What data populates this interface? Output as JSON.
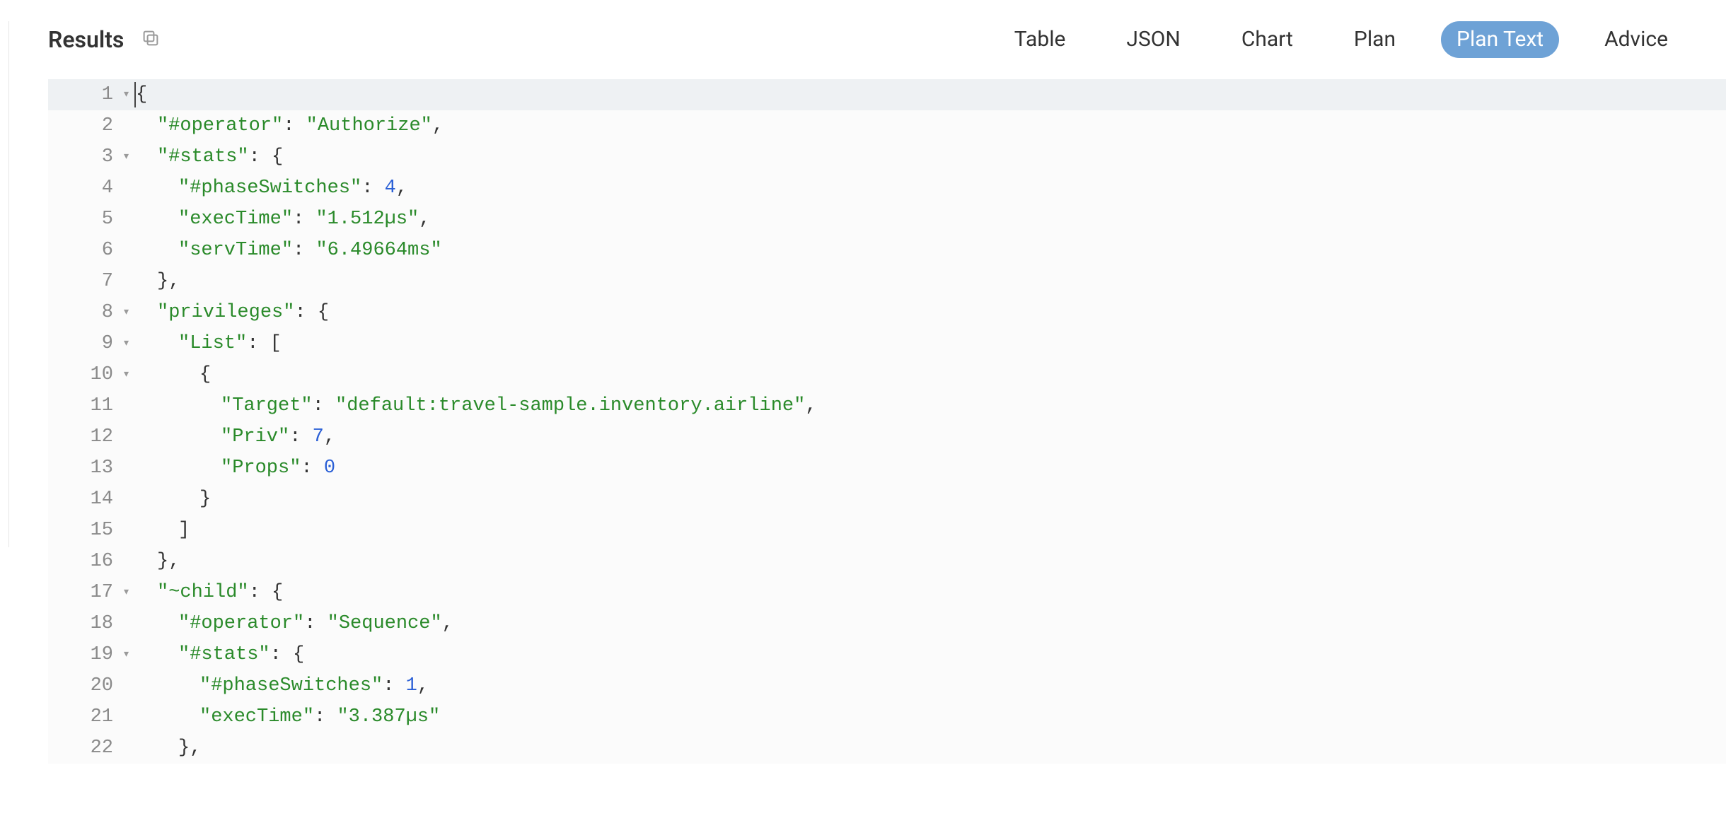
{
  "header": {
    "title": "Results",
    "tabs": [
      {
        "id": "table",
        "label": "Table",
        "active": false
      },
      {
        "id": "json",
        "label": "JSON",
        "active": false
      },
      {
        "id": "chart",
        "label": "Chart",
        "active": false
      },
      {
        "id": "plan",
        "label": "Plan",
        "active": false
      },
      {
        "id": "plantext",
        "label": "Plan Text",
        "active": true
      },
      {
        "id": "advice",
        "label": "Advice",
        "active": false
      }
    ]
  },
  "code": {
    "lines": [
      {
        "n": 1,
        "fold": true,
        "first": true,
        "indent": 0,
        "guides": [],
        "tokens": [
          [
            "brace",
            "{"
          ]
        ]
      },
      {
        "n": 2,
        "fold": false,
        "indent": 1,
        "guides": [],
        "tokens": [
          [
            "key",
            "\"#operator\""
          ],
          [
            "punc",
            ": "
          ],
          [
            "str",
            "\"Authorize\""
          ],
          [
            "punc",
            ","
          ]
        ]
      },
      {
        "n": 3,
        "fold": true,
        "indent": 1,
        "guides": [],
        "tokens": [
          [
            "key",
            "\"#stats\""
          ],
          [
            "punc",
            ": "
          ],
          [
            "brace",
            "{"
          ]
        ]
      },
      {
        "n": 4,
        "fold": false,
        "indent": 2,
        "guides": [
          1
        ],
        "tokens": [
          [
            "key",
            "\"#phaseSwitches\""
          ],
          [
            "punc",
            ": "
          ],
          [
            "num",
            "4"
          ],
          [
            "punc",
            ","
          ]
        ]
      },
      {
        "n": 5,
        "fold": false,
        "indent": 2,
        "guides": [
          1
        ],
        "tokens": [
          [
            "key",
            "\"execTime\""
          ],
          [
            "punc",
            ": "
          ],
          [
            "str",
            "\"1.512µs\""
          ],
          [
            "punc",
            ","
          ]
        ]
      },
      {
        "n": 6,
        "fold": false,
        "indent": 2,
        "guides": [
          1
        ],
        "tokens": [
          [
            "key",
            "\"servTime\""
          ],
          [
            "punc",
            ": "
          ],
          [
            "str",
            "\"6.49664ms\""
          ]
        ]
      },
      {
        "n": 7,
        "fold": false,
        "indent": 1,
        "guides": [],
        "tokens": [
          [
            "brace",
            "}"
          ],
          [
            "punc",
            ","
          ]
        ]
      },
      {
        "n": 8,
        "fold": true,
        "indent": 1,
        "guides": [],
        "tokens": [
          [
            "key",
            "\"privileges\""
          ],
          [
            "punc",
            ": "
          ],
          [
            "brace",
            "{"
          ]
        ]
      },
      {
        "n": 9,
        "fold": true,
        "indent": 2,
        "guides": [
          1
        ],
        "tokens": [
          [
            "key",
            "\"List\""
          ],
          [
            "punc",
            ": "
          ],
          [
            "brace",
            "["
          ]
        ]
      },
      {
        "n": 10,
        "fold": true,
        "indent": 3,
        "guides": [
          1,
          2
        ],
        "tokens": [
          [
            "brace",
            "{"
          ]
        ]
      },
      {
        "n": 11,
        "fold": false,
        "indent": 4,
        "guides": [
          1,
          2,
          3
        ],
        "tokens": [
          [
            "key",
            "\"Target\""
          ],
          [
            "punc",
            ": "
          ],
          [
            "str",
            "\"default:travel-sample.inventory.airline\""
          ],
          [
            "punc",
            ","
          ]
        ]
      },
      {
        "n": 12,
        "fold": false,
        "indent": 4,
        "guides": [
          1,
          2,
          3
        ],
        "tokens": [
          [
            "key",
            "\"Priv\""
          ],
          [
            "punc",
            ": "
          ],
          [
            "num",
            "7"
          ],
          [
            "punc",
            ","
          ]
        ]
      },
      {
        "n": 13,
        "fold": false,
        "indent": 4,
        "guides": [
          1,
          2,
          3
        ],
        "tokens": [
          [
            "key",
            "\"Props\""
          ],
          [
            "punc",
            ": "
          ],
          [
            "num",
            "0"
          ]
        ]
      },
      {
        "n": 14,
        "fold": false,
        "indent": 3,
        "guides": [
          1,
          2
        ],
        "tokens": [
          [
            "brace",
            "}"
          ]
        ]
      },
      {
        "n": 15,
        "fold": false,
        "indent": 2,
        "guides": [
          1
        ],
        "tokens": [
          [
            "brace",
            "]"
          ]
        ]
      },
      {
        "n": 16,
        "fold": false,
        "indent": 1,
        "guides": [],
        "tokens": [
          [
            "brace",
            "}"
          ],
          [
            "punc",
            ","
          ]
        ]
      },
      {
        "n": 17,
        "fold": true,
        "indent": 1,
        "guides": [],
        "tokens": [
          [
            "key",
            "\"~child\""
          ],
          [
            "punc",
            ": "
          ],
          [
            "brace",
            "{"
          ]
        ]
      },
      {
        "n": 18,
        "fold": false,
        "indent": 2,
        "guides": [
          1
        ],
        "tokens": [
          [
            "key",
            "\"#operator\""
          ],
          [
            "punc",
            ": "
          ],
          [
            "str",
            "\"Sequence\""
          ],
          [
            "punc",
            ","
          ]
        ]
      },
      {
        "n": 19,
        "fold": true,
        "indent": 2,
        "guides": [
          1
        ],
        "tokens": [
          [
            "key",
            "\"#stats\""
          ],
          [
            "punc",
            ": "
          ],
          [
            "brace",
            "{"
          ]
        ]
      },
      {
        "n": 20,
        "fold": false,
        "indent": 3,
        "guides": [
          1,
          2
        ],
        "tokens": [
          [
            "key",
            "\"#phaseSwitches\""
          ],
          [
            "punc",
            ": "
          ],
          [
            "num",
            "1"
          ],
          [
            "punc",
            ","
          ]
        ]
      },
      {
        "n": 21,
        "fold": false,
        "indent": 3,
        "guides": [
          1,
          2
        ],
        "tokens": [
          [
            "key",
            "\"execTime\""
          ],
          [
            "punc",
            ": "
          ],
          [
            "str",
            "\"3.387µs\""
          ]
        ]
      },
      {
        "n": 22,
        "fold": false,
        "indent": 2,
        "guides": [
          1
        ],
        "tokens": [
          [
            "brace",
            "}"
          ],
          [
            "punc",
            ","
          ]
        ]
      }
    ]
  }
}
